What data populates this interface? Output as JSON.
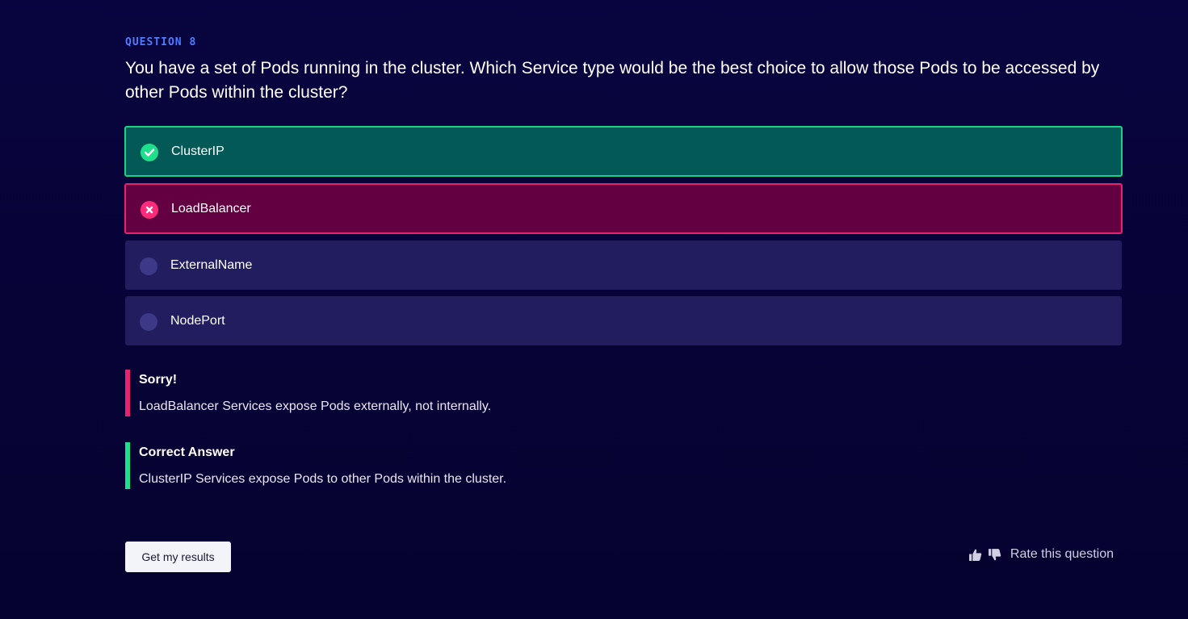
{
  "question": {
    "label": "QUESTION 8",
    "text": "You have a set of Pods running in the cluster. Which Service type would be the best choice to allow those Pods to be accessed by other Pods within the cluster?"
  },
  "options": [
    {
      "label": "ClusterIP",
      "state": "correct",
      "icon": "check-icon"
    },
    {
      "label": "LoadBalancer",
      "state": "wrong",
      "icon": "close-icon"
    },
    {
      "label": "ExternalName",
      "state": "neutral",
      "icon": "radio-icon"
    },
    {
      "label": "NodePort",
      "state": "neutral",
      "icon": "radio-icon"
    }
  ],
  "feedback": {
    "sorry": {
      "title": "Sorry!",
      "body": "LoadBalancer Services expose Pods externally, not internally."
    },
    "correct_answer": {
      "title": "Correct Answer",
      "body": "ClusterIP Services expose Pods to other Pods within the cluster."
    }
  },
  "actions": {
    "results_label": "Get my results",
    "rate_label": "Rate this question"
  },
  "colors": {
    "accent_label": "#4f7cff",
    "correct": "#1ee08c",
    "wrong": "#ff2b7a",
    "background": "#08043f"
  }
}
